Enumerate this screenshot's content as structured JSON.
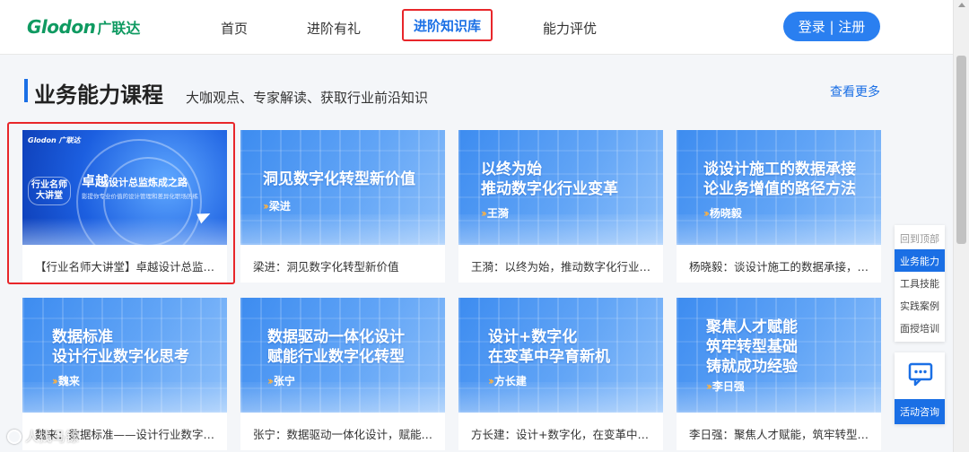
{
  "header": {
    "logo_en": "Glodon",
    "logo_cn": "广联达",
    "nav": [
      "首页",
      "进阶有礼",
      "进阶知识库",
      "能力评优"
    ],
    "login_label": "登录 | 注册"
  },
  "section": {
    "title": "业务能力课程",
    "subtitle": "大咖观点、专家解读、获取行业前沿知识",
    "view_more": "查看更多"
  },
  "featured": {
    "logo": "Glodon 广联达",
    "left_badge": "行业名师\n大讲堂",
    "main_big": "卓越",
    "main_small": "设计总监炼成之路",
    "sub": "影提你专业价值的设计管理和差异化职场历练",
    "caption": "【行业名师大讲堂】卓越设计总监炼成之路"
  },
  "cards": [
    {
      "title": "洞见数字化转型新价值",
      "author": "梁进",
      "caption": "梁进：洞见数字化转型新价值"
    },
    {
      "title": "以终为始\n推动数字化行业变革",
      "author": "王漪",
      "caption": "王漪：以终为始，推动数字化行业变革"
    },
    {
      "title": "谈设计施工的数据承接\n论业务增值的路径方法",
      "author": "杨晓毅",
      "caption": "杨晓毅：谈设计施工的数据承接，论业务增值的路径方法"
    },
    {
      "title": "数据标准\n设计行业数字化思考",
      "author": "魏来",
      "caption": "魏来：数据标准——设计行业数字化思考"
    },
    {
      "title": "数据驱动一体化设计\n赋能行业数字化转型",
      "author": "张宁",
      "caption": "张宁：数据驱动一体化设计，赋能行业数字化转型"
    },
    {
      "title": "设计+数字化\n在变革中孕育新机",
      "author": "方长建",
      "caption": "方长建：设计+数字化，在变革中孕育新机"
    },
    {
      "title": "聚焦人才赋能\n筑牢转型基础\n铸就成功经验",
      "author": "李日强",
      "caption": "李日强：聚焦人才赋能，筑牢转型基础，铸就成功经验"
    }
  ],
  "float_nav": [
    "回到顶部",
    "业务能力",
    "工具技能",
    "实践案例",
    "面授培训"
  ],
  "consult_label": "活动咨询",
  "watermark": "人找马镖",
  "colors": {
    "accent": "#1a6fe5",
    "highlight": "#e8262a",
    "brand": "#0f9a61"
  }
}
